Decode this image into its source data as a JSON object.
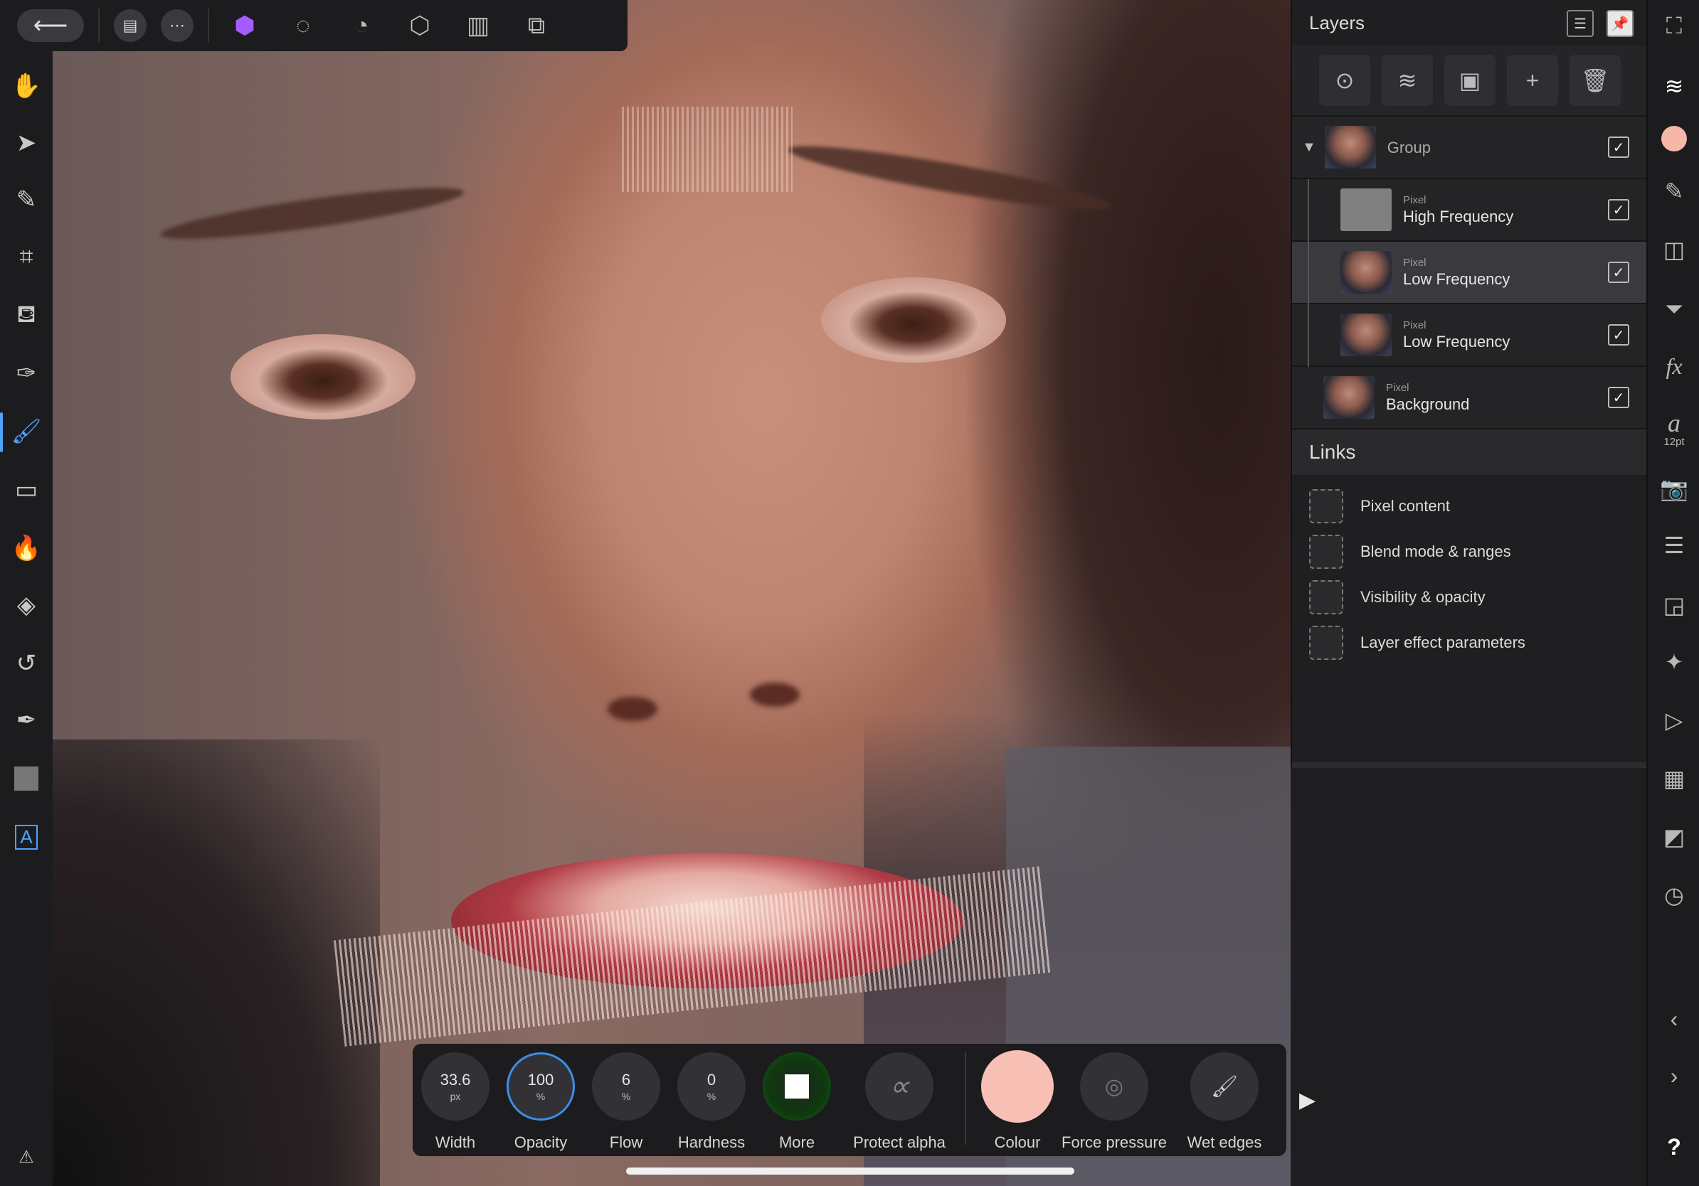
{
  "topbar": {
    "back_icon": "arrow-left-icon",
    "icons": [
      "document-icon",
      "more-icon",
      "photo-persona-icon",
      "liquify-persona-icon",
      "develop-persona-icon",
      "tone-mapping-persona-icon",
      "export-persona-icon",
      "share-icon"
    ]
  },
  "tools": [
    "hand-icon",
    "move-icon",
    "color-picker-icon",
    "crop-icon",
    "flood-fill-icon",
    "selection-brush-icon",
    "paint-brush-icon",
    "erase-icon",
    "dodge-burn-icon",
    "healing-icon",
    "clone-icon",
    "pen-icon",
    "rectangle-icon",
    "text-icon"
  ],
  "layers_panel": {
    "title": "Layers",
    "rows": [
      {
        "type": "",
        "name": "Group"
      },
      {
        "type": "Pixel",
        "name": "High Frequency"
      },
      {
        "type": "Pixel",
        "name": "Low Frequency"
      },
      {
        "type": "Pixel",
        "name": "Low Frequency"
      },
      {
        "type": "Pixel",
        "name": "Background"
      }
    ]
  },
  "links_panel": {
    "title": "Links",
    "items": [
      "Pixel content",
      "Blend mode & ranges",
      "Visibility & opacity",
      "Layer effect parameters"
    ]
  },
  "right_rail": {
    "font_size_label": "12pt",
    "help_label": "?"
  },
  "context_toolbar": {
    "width": {
      "value": "33.6",
      "unit": "px",
      "label": "Width"
    },
    "opacity": {
      "value": "100",
      "unit": "%",
      "label": "Opacity"
    },
    "flow": {
      "value": "6",
      "unit": "%",
      "label": "Flow"
    },
    "hardness": {
      "value": "0",
      "unit": "%",
      "label": "Hardness"
    },
    "more": {
      "label": "More"
    },
    "protect_alpha": {
      "symbol": "∝",
      "label": "Protect alpha"
    },
    "colour": {
      "label": "Colour",
      "hex": "#f8c0b4"
    },
    "force_pressure": {
      "label": "Force pressure"
    },
    "wet_edges": {
      "label": "Wet edges"
    }
  }
}
